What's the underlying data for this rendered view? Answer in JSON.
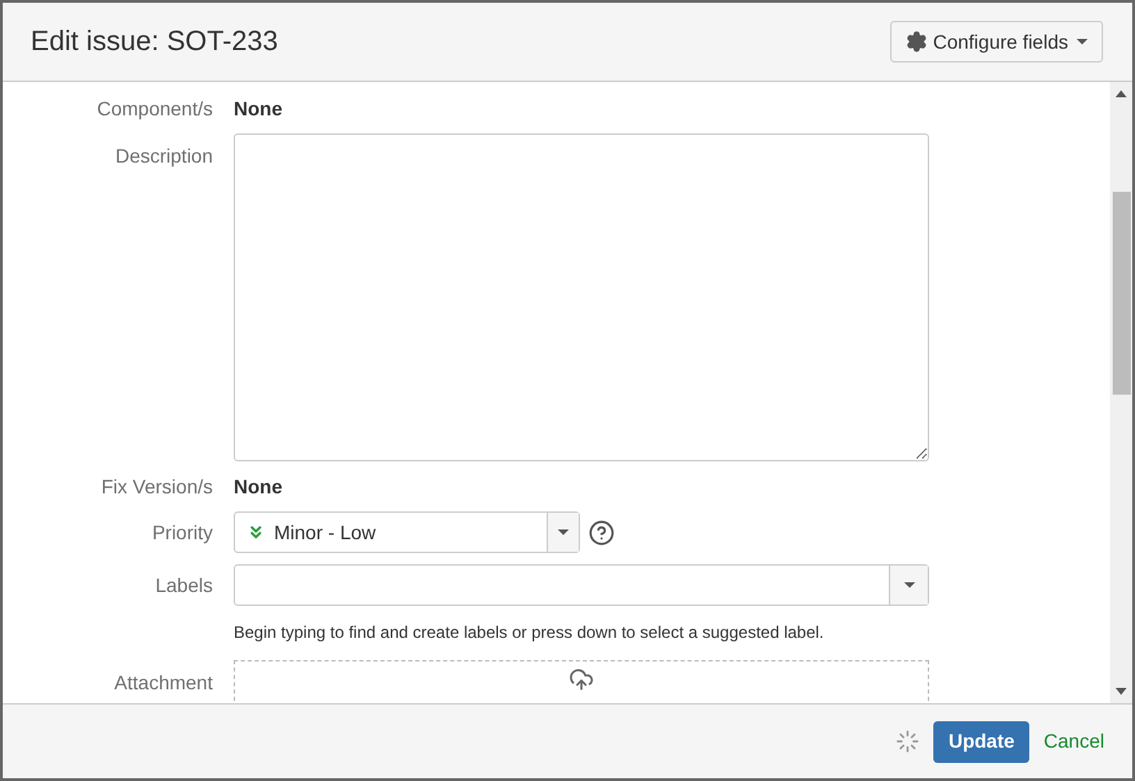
{
  "dialog": {
    "title": "Edit issue: SOT-233",
    "configure_button": "Configure fields"
  },
  "fields": [
    {
      "kind": "static",
      "label": "Component/s",
      "value": "None"
    },
    {
      "kind": "textarea",
      "label": "Description"
    },
    {
      "kind": "static",
      "label": "Fix Version/s",
      "value": "None"
    },
    {
      "kind": "priority",
      "label": "Priority",
      "value": "Minor - Low"
    },
    {
      "kind": "labels",
      "label": "Labels",
      "hint": "Begin typing to find and create labels or press down to select a suggested label."
    },
    {
      "kind": "attachment",
      "label": "Attachment"
    }
  ],
  "footer": {
    "update_button": "Update",
    "cancel_link": "Cancel"
  }
}
